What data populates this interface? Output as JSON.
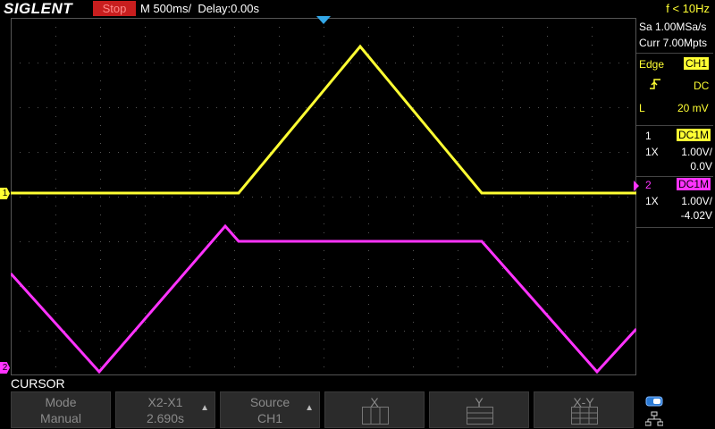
{
  "header": {
    "brand": "SIGLENT",
    "run_status": "Stop",
    "timebase": "M 500ms/",
    "delay": "Delay:0.00s",
    "frequency": "f < 10Hz"
  },
  "acquisition": {
    "sample_rate": "Sa 1.00MSa/s",
    "memory_depth": "Curr 7.00Mpts"
  },
  "trigger": {
    "type": "Edge",
    "source": "CH1",
    "coupling": "DC",
    "level_label": "L",
    "level": "20 mV"
  },
  "channels": [
    {
      "number": "1",
      "coupling": "DC1M",
      "probe": "1X",
      "scale": "1.00V/",
      "offset": "0.0V",
      "color": "#ffff33"
    },
    {
      "number": "2",
      "coupling": "DC1M",
      "probe": "1X",
      "scale": "1.00V/",
      "offset": "-4.02V",
      "color": "#ff33ff"
    }
  ],
  "menu": {
    "title": "CURSOR",
    "softkeys": [
      {
        "label": "Mode",
        "value": "Manual"
      },
      {
        "label": "X2-X1",
        "value": "2.690s"
      },
      {
        "label": "Source",
        "value": "CH1"
      },
      {
        "label": "X",
        "value": ""
      },
      {
        "label": "Y",
        "value": ""
      },
      {
        "label": "X-Y",
        "value": ""
      }
    ]
  },
  "markers": {
    "ch1": "1",
    "ch2": "2"
  },
  "icons": [
    "trigger-position-icon",
    "rising-edge-icon",
    "usb-icon",
    "network-icon"
  ]
}
